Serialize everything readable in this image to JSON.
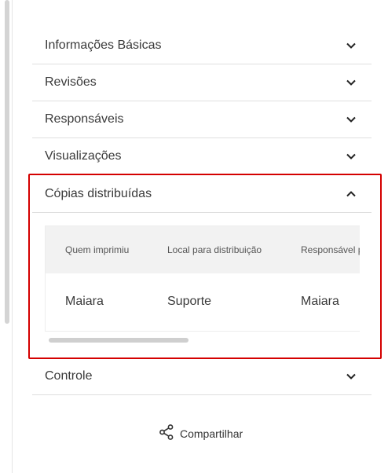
{
  "accordion": {
    "items": [
      {
        "label": "Informações Básicas"
      },
      {
        "label": "Revisões"
      },
      {
        "label": "Responsáveis"
      },
      {
        "label": "Visualizações"
      }
    ],
    "open_section": {
      "label": "Cópias distribuídas",
      "table": {
        "headers": [
          "Quem imprimiu",
          "Local para distribuição",
          "Responsável pela distribuição"
        ],
        "rows": [
          [
            "Maiara",
            "Suporte",
            "Maiara"
          ]
        ]
      }
    },
    "after_items": [
      {
        "label": "Controle"
      }
    ]
  },
  "share": {
    "label": "Compartilhar"
  },
  "icons": {
    "collapsed": "chevron-down-icon",
    "expanded": "chevron-up-icon",
    "share": "share-icon"
  },
  "colors": {
    "highlight": "#d40000"
  }
}
